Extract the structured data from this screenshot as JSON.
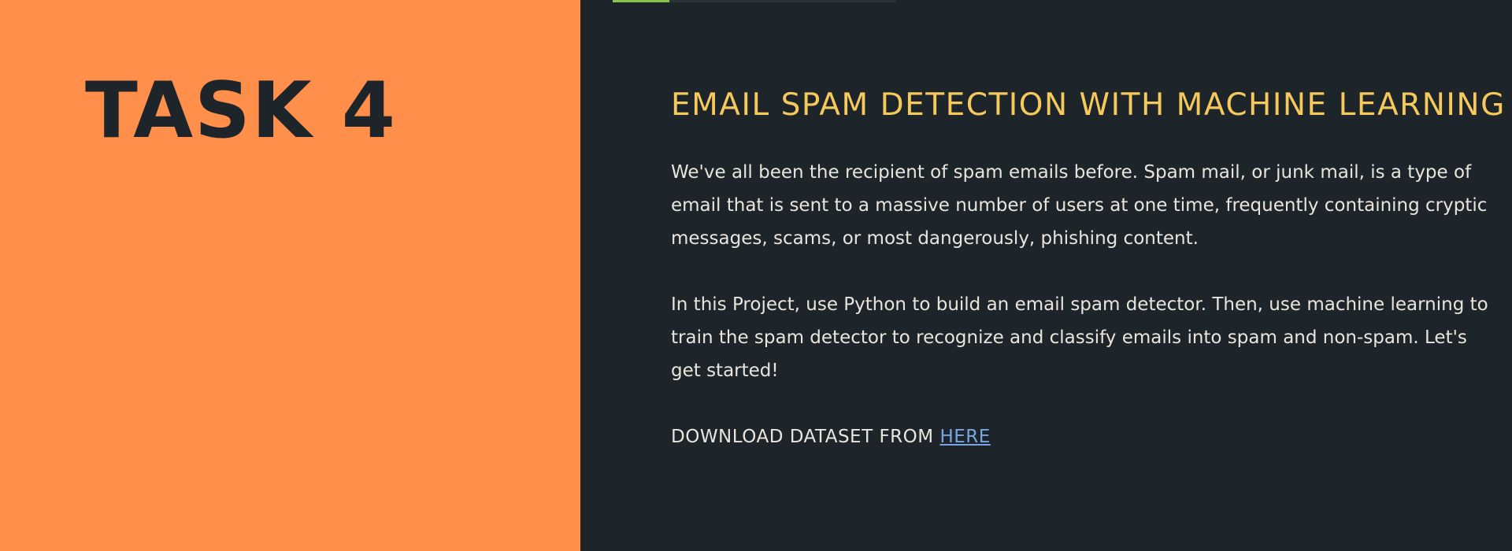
{
  "task": {
    "title": "TASK 4"
  },
  "section": {
    "heading": "EMAIL SPAM DETECTION WITH MACHINE LEARNING",
    "paragraphs": [
      "We've all been the recipient of spam emails before. Spam mail, or junk mail, is a type of email that is sent to a massive number of users at one time, frequently containing cryptic messages, scams, or most dangerously, phishing content.",
      "In this Project, use Python to build an email spam detector. Then, use machine learning to train the spam detector to recognize and classify emails into spam and non-spam. Let's get started!"
    ],
    "download_prefix": "DOWNLOAD DATASET FROM ",
    "download_link": "HERE"
  },
  "progress": {
    "value": 0.2
  },
  "colors": {
    "left_panel": "#ff8f4a",
    "right_panel": "#1e252a",
    "heading": "#f6c95b",
    "body_text": "#e9e5dd",
    "link": "#79a6e0",
    "progress_fill": "#8bc34a"
  }
}
